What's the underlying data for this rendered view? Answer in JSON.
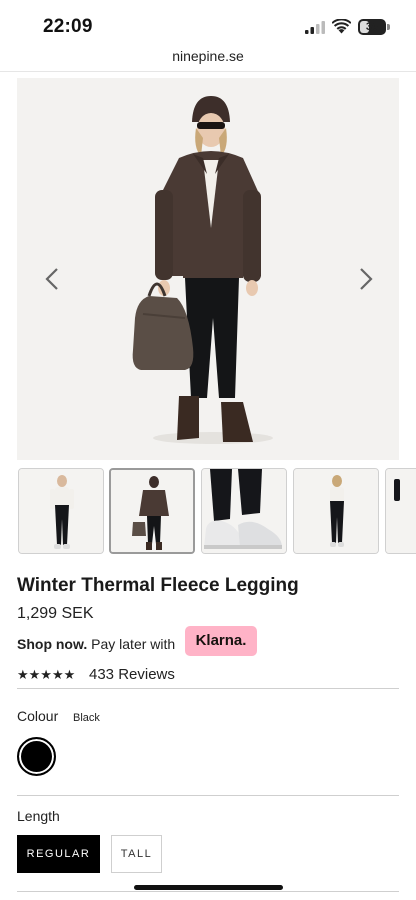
{
  "status_bar": {
    "time": "22:09",
    "battery": "36",
    "battery_level": 0.36
  },
  "browser": {
    "url": "ninepine.se"
  },
  "gallery": {
    "prev_icon": "chevron-left-icon",
    "next_icon": "chevron-right-icon",
    "thumbnails": [
      "front-view",
      "jacket-view",
      "shoes-detail",
      "back-view",
      "partial"
    ]
  },
  "product": {
    "title": "Winter Thermal Fleece Legging",
    "price": "1,299 SEK",
    "klarna": {
      "shop_now": "Shop now.",
      "pay_later": "Pay later with",
      "brand": "Klarna."
    },
    "rating": {
      "stars": "★★★★★",
      "value": 4.5,
      "reviews": "433 Reviews"
    }
  },
  "options": {
    "colour_label": "Colour",
    "colour_value": "Black",
    "swatch_color": "#000000",
    "length_label": "Length",
    "length_options": [
      "REGULAR",
      "TALL"
    ],
    "length_selected": "REGULAR"
  },
  "colors": {
    "klarna_pink": "#ffb3c7",
    "accent": "#000000"
  }
}
